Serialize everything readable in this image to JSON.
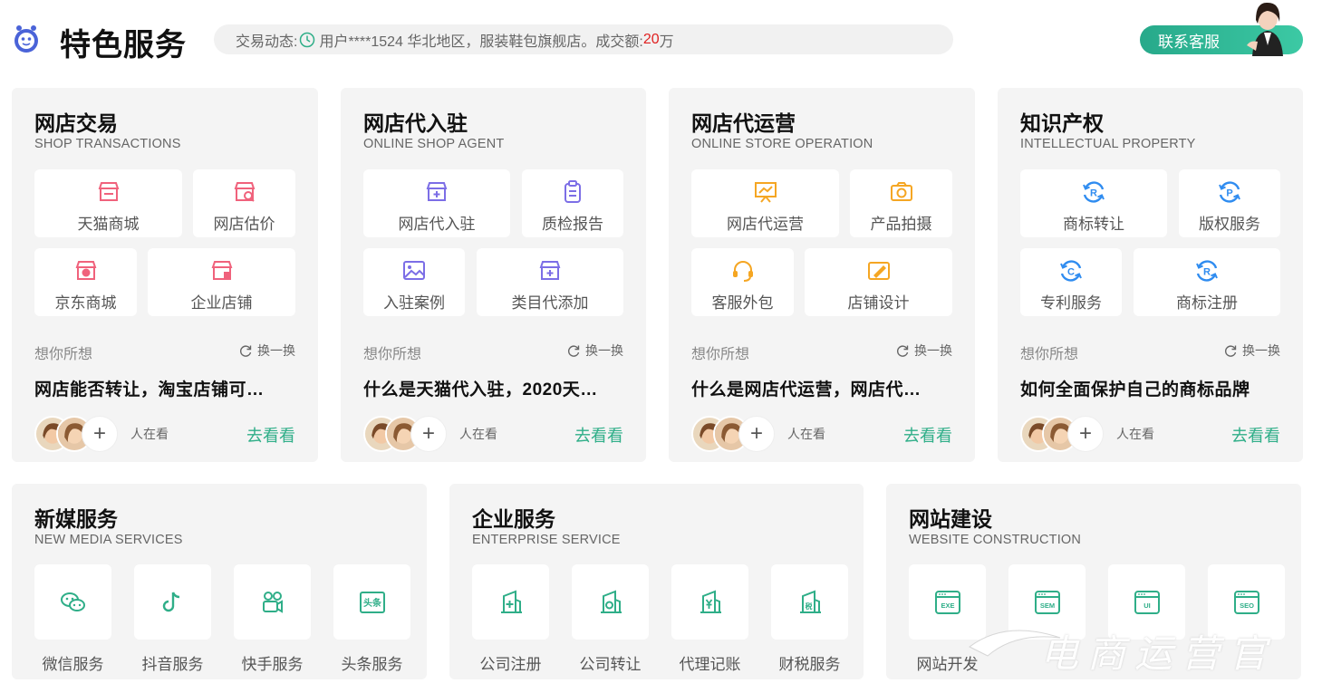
{
  "header": {
    "title": "特色服务",
    "ticker": {
      "prefix": "交易动态:",
      "text": "用户****1524 华北地区，服装鞋包旗舰店。成交额:",
      "amount": "20",
      "unit": "万"
    },
    "contact_label": "联系客服"
  },
  "top_cards": [
    {
      "title": "网店交易",
      "subtitle": "SHOP TRANSACTIONS",
      "tiles": [
        "天猫商城",
        "网店估价",
        "京东商城",
        "企业店铺"
      ],
      "think_label": "想你所想",
      "swap_label": "换一换",
      "question": "网店能否转让，淘宝店铺可…",
      "watching_label": "人在看",
      "go_label": "去看看"
    },
    {
      "title": "网店代入驻",
      "subtitle": "ONLINE SHOP AGENT",
      "tiles": [
        "网店代入驻",
        "质检报告",
        "入驻案例",
        "类目代添加"
      ],
      "think_label": "想你所想",
      "swap_label": "换一换",
      "question": "什么是天猫代入驻，2020天…",
      "watching_label": "人在看",
      "go_label": "去看看"
    },
    {
      "title": "网店代运营",
      "subtitle": "ONLINE STORE OPERATION",
      "tiles": [
        "网店代运营",
        "产品拍摄",
        "客服外包",
        "店铺设计"
      ],
      "think_label": "想你所想",
      "swap_label": "换一换",
      "question": "什么是网店代运营，网店代…",
      "watching_label": "人在看",
      "go_label": "去看看"
    },
    {
      "title": "知识产权",
      "subtitle": "INTELLECTUAL PROPERTY",
      "tiles": [
        "商标转让",
        "版权服务",
        "专利服务",
        "商标注册"
      ],
      "think_label": "想你所想",
      "swap_label": "换一换",
      "question": "如何全面保护自己的商标品牌",
      "watching_label": "人在看",
      "go_label": "去看看"
    }
  ],
  "bottom_cards": [
    {
      "title": "新媒服务",
      "subtitle": "NEW MEDIA SERVICES",
      "items": [
        "微信服务",
        "抖音服务",
        "快手服务",
        "头条服务"
      ]
    },
    {
      "title": "企业服务",
      "subtitle": "ENTERPRISE SERVICE",
      "items": [
        "公司注册",
        "公司转让",
        "代理记账",
        "财税服务"
      ]
    },
    {
      "title": "网站建设",
      "subtitle": "WEBSITE CONSTRUCTION",
      "items": [
        "网站开发",
        "",
        "",
        ""
      ],
      "icon_texts": [
        "EXE",
        "SEM",
        "UI",
        "SEO"
      ]
    }
  ],
  "watermark": "电商运营官",
  "colors": {
    "accent_green": "#2fae88",
    "pink": "#f0627c",
    "purple": "#7c6ee6",
    "orange": "#f5a623",
    "blue": "#2f8cf0",
    "amount_red": "#e02020"
  }
}
